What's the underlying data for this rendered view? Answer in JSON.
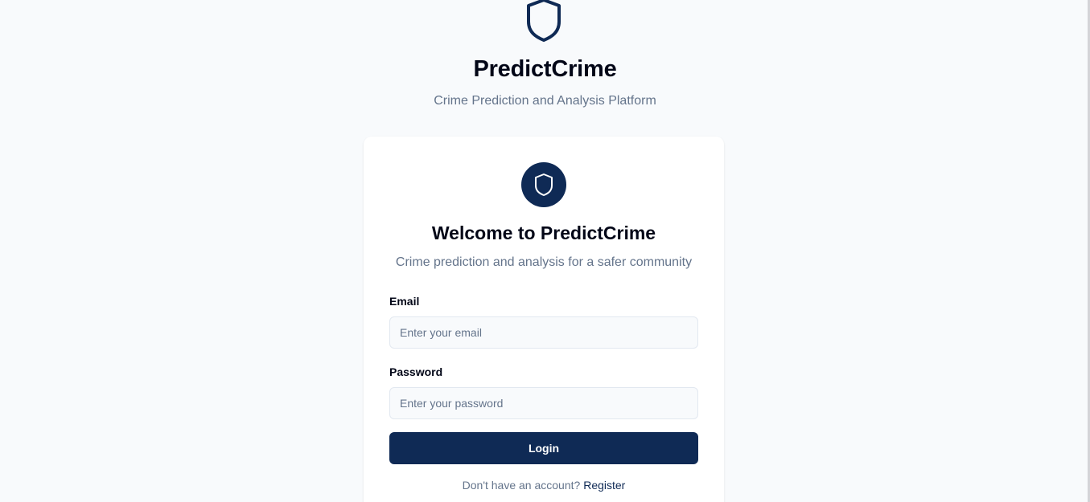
{
  "brand": {
    "icon": "shield-icon",
    "title": "PredictCrime",
    "subtitle": "Crime Prediction and Analysis Platform"
  },
  "login_card": {
    "badge_icon": "shield-icon",
    "title": "Welcome to PredictCrime",
    "subtitle": "Crime prediction and analysis for a safer community",
    "email": {
      "label": "Email",
      "placeholder": "Enter your email",
      "value": ""
    },
    "password": {
      "label": "Password",
      "placeholder": "Enter your password",
      "value": ""
    },
    "login_label": "Login",
    "register_prompt": "Don't have an account?",
    "register_link": "Register"
  },
  "colors": {
    "primary": "#0f2a55",
    "background": "#f8fafc",
    "muted_text": "#64748b"
  }
}
